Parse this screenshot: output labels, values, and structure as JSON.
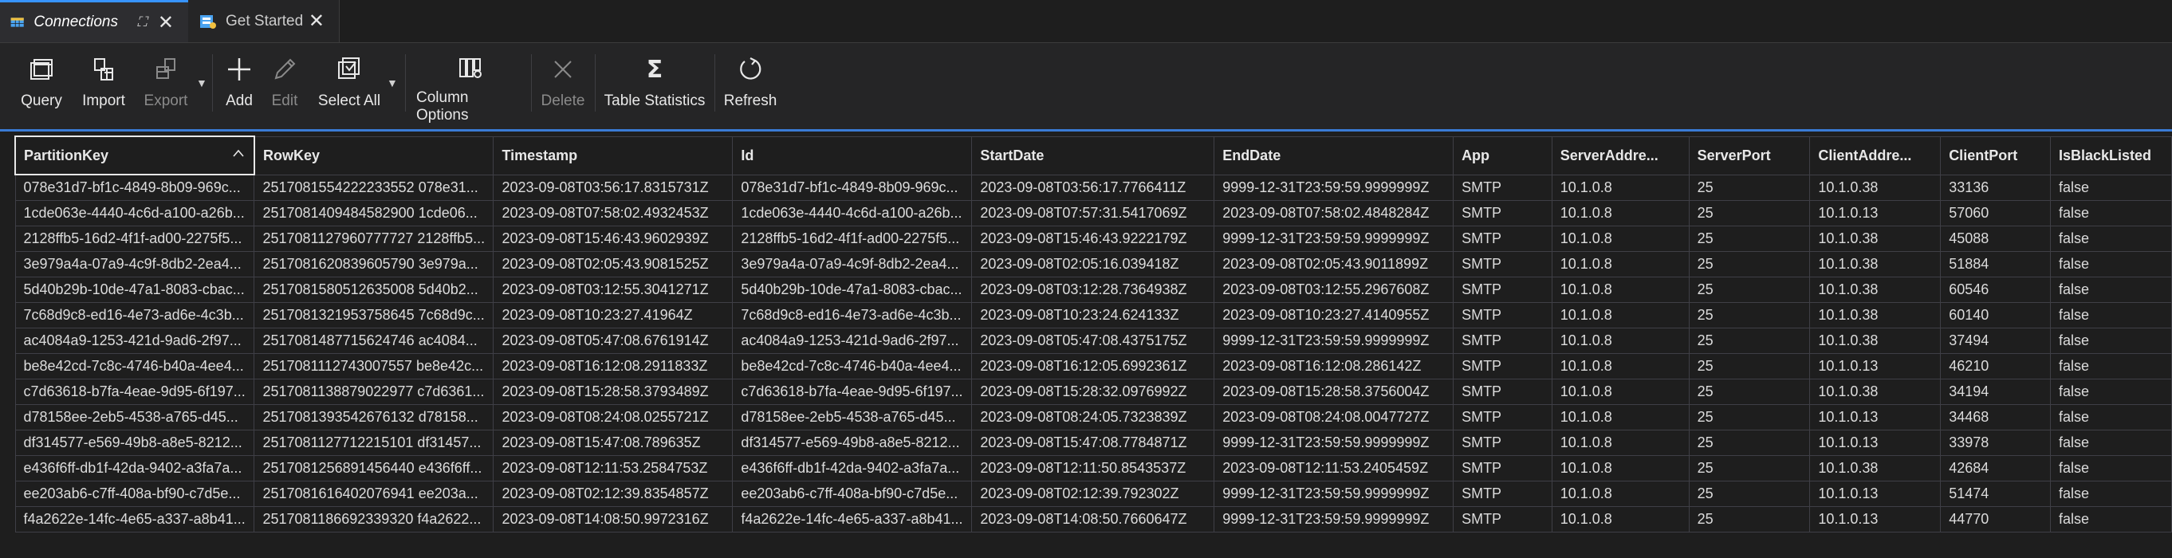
{
  "tabs": [
    {
      "label": "Connections"
    },
    {
      "label": "Get Started"
    }
  ],
  "toolbar": {
    "query": "Query",
    "import": "Import",
    "export": "Export",
    "add": "Add",
    "edit": "Edit",
    "select_all": "Select All",
    "column_options": "Column Options",
    "delete": "Delete",
    "table_statistics": "Table Statistics",
    "refresh": "Refresh"
  },
  "grid": {
    "columns": [
      "PartitionKey",
      "RowKey",
      "Timestamp",
      "Id",
      "StartDate",
      "EndDate",
      "App",
      "ServerAddre...",
      "ServerPort",
      "ClientAddre...",
      "ClientPort",
      "IsBlackListed"
    ],
    "rows": [
      [
        "078e31d7-bf1c-4849-8b09-969c...",
        "2517081554222233552 078e31...",
        "2023-09-08T03:56:17.8315731Z",
        "078e31d7-bf1c-4849-8b09-969c...",
        "2023-09-08T03:56:17.7766411Z",
        "9999-12-31T23:59:59.9999999Z",
        "SMTP",
        "10.1.0.8",
        "25",
        "10.1.0.38",
        "33136",
        "false"
      ],
      [
        "1cde063e-4440-4c6d-a100-a26b...",
        "2517081409484582900 1cde06...",
        "2023-09-08T07:58:02.4932453Z",
        "1cde063e-4440-4c6d-a100-a26b...",
        "2023-09-08T07:57:31.5417069Z",
        "2023-09-08T07:58:02.4848284Z",
        "SMTP",
        "10.1.0.8",
        "25",
        "10.1.0.13",
        "57060",
        "false"
      ],
      [
        "2128ffb5-16d2-4f1f-ad00-2275f5...",
        "2517081127960777727 2128ffb5...",
        "2023-09-08T15:46:43.9602939Z",
        "2128ffb5-16d2-4f1f-ad00-2275f5...",
        "2023-09-08T15:46:43.9222179Z",
        "9999-12-31T23:59:59.9999999Z",
        "SMTP",
        "10.1.0.8",
        "25",
        "10.1.0.38",
        "45088",
        "false"
      ],
      [
        "3e979a4a-07a9-4c9f-8db2-2ea4...",
        "2517081620839605790 3e979a...",
        "2023-09-08T02:05:43.9081525Z",
        "3e979a4a-07a9-4c9f-8db2-2ea4...",
        "2023-09-08T02:05:16.039418Z",
        "2023-09-08T02:05:43.9011899Z",
        "SMTP",
        "10.1.0.8",
        "25",
        "10.1.0.38",
        "51884",
        "false"
      ],
      [
        "5d40b29b-10de-47a1-8083-cbac...",
        "2517081580512635008 5d40b2...",
        "2023-09-08T03:12:55.3041271Z",
        "5d40b29b-10de-47a1-8083-cbac...",
        "2023-09-08T03:12:28.7364938Z",
        "2023-09-08T03:12:55.2967608Z",
        "SMTP",
        "10.1.0.8",
        "25",
        "10.1.0.38",
        "60546",
        "false"
      ],
      [
        "7c68d9c8-ed16-4e73-ad6e-4c3b...",
        "2517081321953758645 7c68d9c...",
        "2023-09-08T10:23:27.41964Z",
        "7c68d9c8-ed16-4e73-ad6e-4c3b...",
        "2023-09-08T10:23:24.624133Z",
        "2023-09-08T10:23:27.4140955Z",
        "SMTP",
        "10.1.0.8",
        "25",
        "10.1.0.38",
        "60140",
        "false"
      ],
      [
        "ac4084a9-1253-421d-9ad6-2f97...",
        "2517081487715624746 ac4084...",
        "2023-09-08T05:47:08.6761914Z",
        "ac4084a9-1253-421d-9ad6-2f97...",
        "2023-09-08T05:47:08.4375175Z",
        "9999-12-31T23:59:59.9999999Z",
        "SMTP",
        "10.1.0.8",
        "25",
        "10.1.0.38",
        "37494",
        "false"
      ],
      [
        "be8e42cd-7c8c-4746-b40a-4ee4...",
        "2517081112743007557 be8e42c...",
        "2023-09-08T16:12:08.2911833Z",
        "be8e42cd-7c8c-4746-b40a-4ee4...",
        "2023-09-08T16:12:05.6992361Z",
        "2023-09-08T16:12:08.286142Z",
        "SMTP",
        "10.1.0.8",
        "25",
        "10.1.0.13",
        "46210",
        "false"
      ],
      [
        "c7d63618-b7fa-4eae-9d95-6f197...",
        "2517081138879022977 c7d6361...",
        "2023-09-08T15:28:58.3793489Z",
        "c7d63618-b7fa-4eae-9d95-6f197...",
        "2023-09-08T15:28:32.0976992Z",
        "2023-09-08T15:28:58.3756004Z",
        "SMTP",
        "10.1.0.8",
        "25",
        "10.1.0.38",
        "34194",
        "false"
      ],
      [
        "d78158ee-2eb5-4538-a765-d45...",
        "2517081393542676132 d78158...",
        "2023-09-08T08:24:08.0255721Z",
        "d78158ee-2eb5-4538-a765-d45...",
        "2023-09-08T08:24:05.7323839Z",
        "2023-09-08T08:24:08.0047727Z",
        "SMTP",
        "10.1.0.8",
        "25",
        "10.1.0.13",
        "34468",
        "false"
      ],
      [
        "df314577-e569-49b8-a8e5-8212...",
        "2517081127712215101 df31457...",
        "2023-09-08T15:47:08.789635Z",
        "df314577-e569-49b8-a8e5-8212...",
        "2023-09-08T15:47:08.7784871Z",
        "9999-12-31T23:59:59.9999999Z",
        "SMTP",
        "10.1.0.8",
        "25",
        "10.1.0.13",
        "33978",
        "false"
      ],
      [
        "e436f6ff-db1f-42da-9402-a3fa7a...",
        "2517081256891456440 e436f6ff...",
        "2023-09-08T12:11:53.2584753Z",
        "e436f6ff-db1f-42da-9402-a3fa7a...",
        "2023-09-08T12:11:50.8543537Z",
        "2023-09-08T12:11:53.2405459Z",
        "SMTP",
        "10.1.0.8",
        "25",
        "10.1.0.38",
        "42684",
        "false"
      ],
      [
        "ee203ab6-c7ff-408a-bf90-c7d5e...",
        "2517081616402076941 ee203a...",
        "2023-09-08T02:12:39.8354857Z",
        "ee203ab6-c7ff-408a-bf90-c7d5e...",
        "2023-09-08T02:12:39.792302Z",
        "9999-12-31T23:59:59.9999999Z",
        "SMTP",
        "10.1.0.8",
        "25",
        "10.1.0.13",
        "51474",
        "false"
      ],
      [
        "f4a2622e-14fc-4e65-a337-a8b41...",
        "2517081186692339320 f4a2622...",
        "2023-09-08T14:08:50.9972316Z",
        "f4a2622e-14fc-4e65-a337-a8b41...",
        "2023-09-08T14:08:50.7660647Z",
        "9999-12-31T23:59:59.9999999Z",
        "SMTP",
        "10.1.0.8",
        "25",
        "10.1.0.13",
        "44770",
        "false"
      ]
    ]
  }
}
